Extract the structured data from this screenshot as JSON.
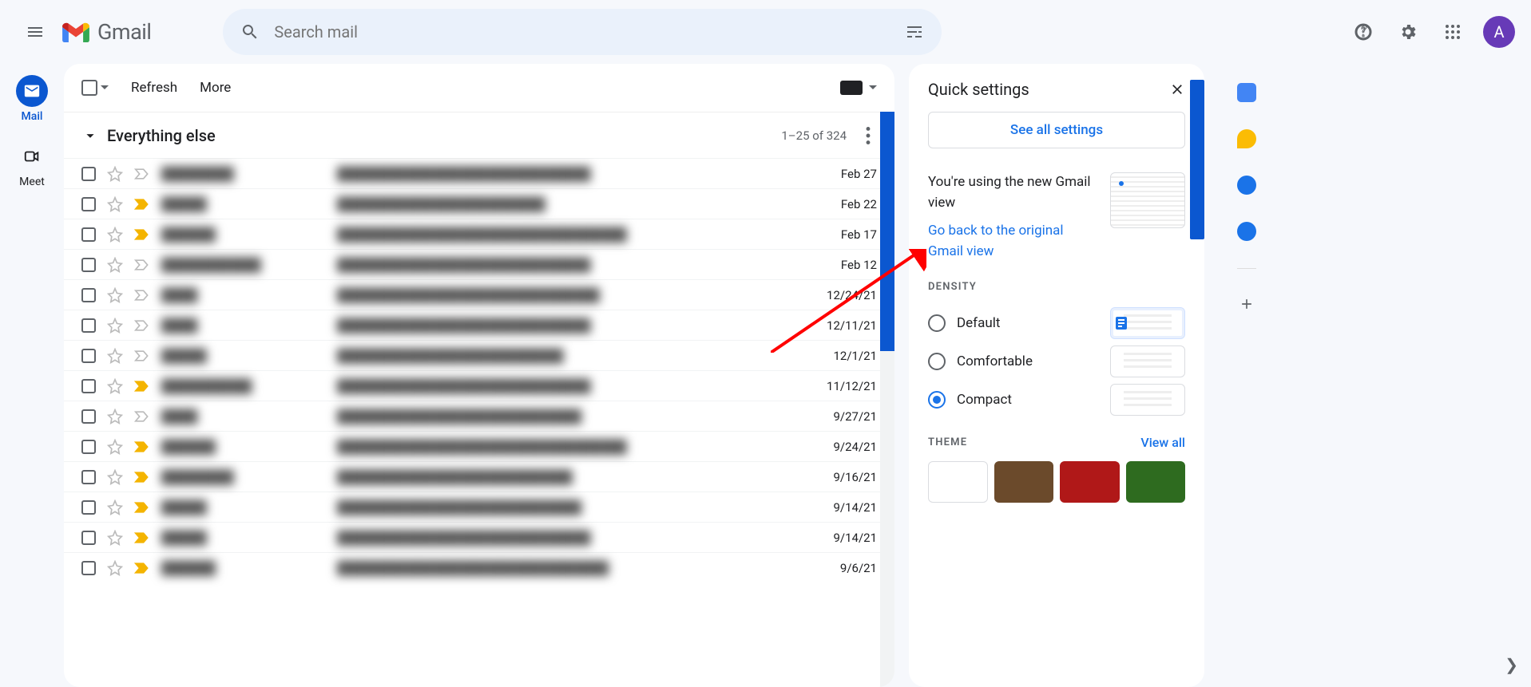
{
  "header": {
    "app_name": "Gmail",
    "search_placeholder": "Search mail",
    "avatar_initial": "A"
  },
  "left_nav": {
    "mail": "Mail",
    "meet": "Meet"
  },
  "toolbar": {
    "refresh": "Refresh",
    "more": "More"
  },
  "section": {
    "title": "Everything else",
    "page_info": "1–25 of 324"
  },
  "rows": [
    {
      "sender": "████████",
      "subject": "████████████████████████████",
      "date": "Feb 27",
      "important": false
    },
    {
      "sender": "█████",
      "subject": "███████████████████████",
      "date": "Feb 22",
      "important": true
    },
    {
      "sender": "██████",
      "subject": "████████████████████████████████",
      "date": "Feb 17",
      "important": true
    },
    {
      "sender": "███████████",
      "subject": "████████████████████████████",
      "date": "Feb 12",
      "important": false
    },
    {
      "sender": "████",
      "subject": "█████████████████████████████",
      "date": "12/24/21",
      "important": false
    },
    {
      "sender": "████",
      "subject": "████████████████████████████",
      "date": "12/11/21",
      "important": false
    },
    {
      "sender": "█████",
      "subject": "█████████████████████████",
      "date": "12/1/21",
      "important": false
    },
    {
      "sender": "██████████",
      "subject": "████████████████████████████",
      "date": "11/12/21",
      "important": true
    },
    {
      "sender": "████",
      "subject": "███████████████████████████",
      "date": "9/27/21",
      "important": false
    },
    {
      "sender": "██████",
      "subject": "████████████████████████████████",
      "date": "9/24/21",
      "important": true
    },
    {
      "sender": "████████",
      "subject": "██████████████████████████",
      "date": "9/16/21",
      "important": true
    },
    {
      "sender": "█████",
      "subject": "███████████████████████████",
      "date": "9/14/21",
      "important": true
    },
    {
      "sender": "█████",
      "subject": "████████████████████████████",
      "date": "9/14/21",
      "important": true
    },
    {
      "sender": "██████",
      "subject": "██████████████████████████████",
      "date": "9/6/21",
      "important": true
    }
  ],
  "qs": {
    "title": "Quick settings",
    "see_all": "See all settings",
    "new_view_msg": "You're using the new Gmail view",
    "go_back": "Go back to the original Gmail view",
    "density_label": "DENSITY",
    "density": {
      "default": "Default",
      "comfortable": "Comfortable",
      "compact": "Compact",
      "selected": "compact"
    },
    "theme_label": "THEME",
    "view_all": "View all",
    "theme_colors": [
      "#ffffff",
      "#6b4a2b",
      "#b01818",
      "#2e6b1f"
    ]
  }
}
